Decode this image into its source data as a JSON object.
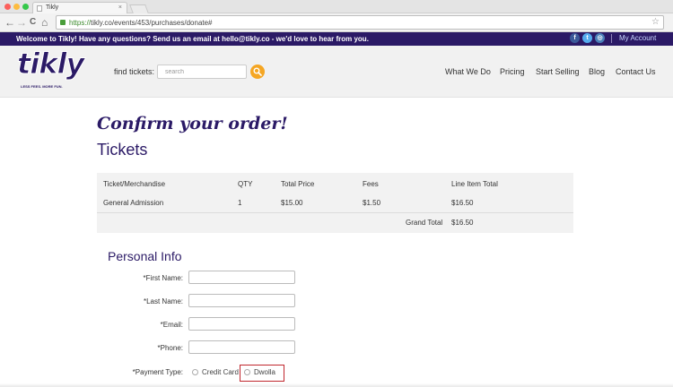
{
  "browser": {
    "tab_title": "Tikly",
    "tab_close": "×",
    "url_scheme": "https://",
    "url_rest": "tikly.co/events/453/purchases/donate#",
    "back": "←",
    "forward": "→",
    "reload": "C",
    "home": "⌂",
    "star": "☆"
  },
  "announcement": {
    "text": "Welcome to Tikly! Have any questions? Send us an email at hello@tikly.co - we'd love to hear from you.",
    "my_account": "My Account",
    "social_icons": [
      "facebook-icon",
      "twitter-icon",
      "instagram-icon"
    ],
    "social_glyphs": [
      "f",
      "t",
      "◎"
    ]
  },
  "header": {
    "logo_text": "tikly",
    "logo_tagline": "LESS FEES. MORE FUN.",
    "find_label": "find tickets:",
    "search_placeholder": "search",
    "nav": [
      "What We Do",
      "Pricing",
      "Start Selling",
      "Blog",
      "Contact Us"
    ]
  },
  "order": {
    "title": "Confirm your order!",
    "tickets_heading": "Tickets",
    "columns": [
      "Ticket/Merchandise",
      "QTY",
      "Total Price",
      "Fees",
      "Line Item Total"
    ],
    "rows": [
      [
        "General Admission",
        "1",
        "$15.00",
        "$1.50",
        "$16.50"
      ]
    ],
    "grand_total_label": "Grand Total",
    "grand_total_value": "$16.50"
  },
  "personal_info": {
    "heading": "Personal Info",
    "fields": [
      "*First Name:",
      "*Last Name:",
      "*Email:",
      "*Phone:"
    ],
    "payment_label": "*Payment Type:",
    "payment_options": [
      "Credit Card",
      "Dwolla"
    ]
  },
  "colors": {
    "brand": "#2b1a66",
    "accent": "#f5a623",
    "highlight": "#c0262d"
  }
}
